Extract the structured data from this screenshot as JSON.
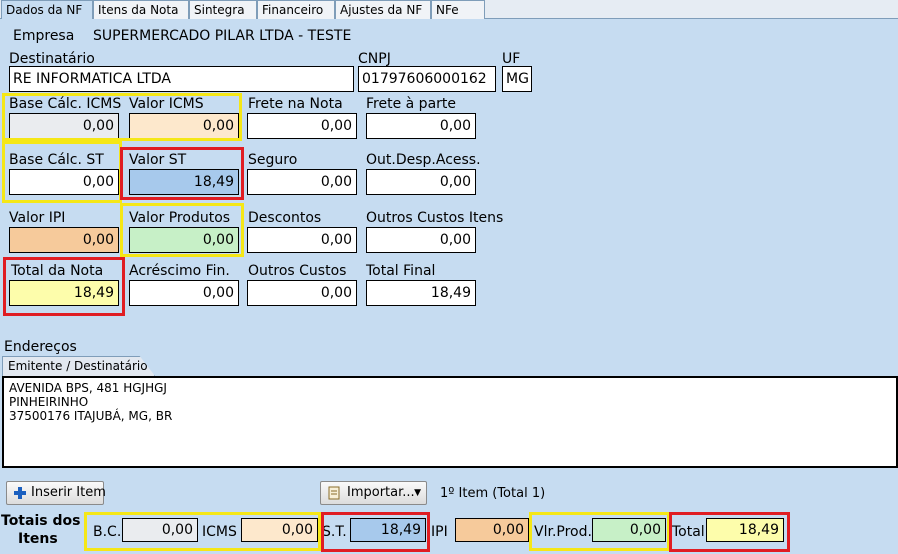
{
  "tabs": [
    "Dados da NF",
    "Itens da Nota",
    "Sintegra",
    "Financeiro",
    "Ajustes da NF",
    "NFe"
  ],
  "empresa": {
    "label": "Empresa",
    "value": "SUPERMERCADO PILAR LTDA - TESTE"
  },
  "destinatario": {
    "label": "Destinatário",
    "value": "RE INFORMATICA LTDA"
  },
  "cnpj": {
    "label": "CNPJ",
    "value": "01797606000162"
  },
  "uf": {
    "label": "UF",
    "value": "MG"
  },
  "fields": {
    "base_icms": {
      "label": "Base Cálc. ICMS",
      "value": "0,00"
    },
    "valor_icms": {
      "label": "Valor ICMS",
      "value": "0,00"
    },
    "frete_nota": {
      "label": "Frete na Nota",
      "value": "0,00"
    },
    "frete_parte": {
      "label": "Frete à parte",
      "value": "0,00"
    },
    "base_st": {
      "label": "Base Cálc. ST",
      "value": "0,00"
    },
    "valor_st": {
      "label": "Valor ST",
      "value": "18,49"
    },
    "seguro": {
      "label": "Seguro",
      "value": "0,00"
    },
    "out_desp": {
      "label": "Out.Desp.Acess.",
      "value": "0,00"
    },
    "valor_ipi": {
      "label": "Valor IPI",
      "value": "0,00"
    },
    "valor_produtos": {
      "label": "Valor Produtos",
      "value": "0,00"
    },
    "descontos": {
      "label": "Descontos",
      "value": "0,00"
    },
    "outros_custos_itens": {
      "label": "Outros Custos Itens",
      "value": "0,00"
    },
    "total_nota": {
      "label": "Total da Nota",
      "value": "18,49"
    },
    "acrescimo": {
      "label": "Acréscimo Fin.",
      "value": "0,00"
    },
    "outros_custos": {
      "label": "Outros Custos",
      "value": "0,00"
    },
    "total_final": {
      "label": "Total Final",
      "value": "18,49"
    }
  },
  "enderecos": {
    "label": "Endereços",
    "tab": "Emitente / Destinatário",
    "lines": [
      "AVENIDA BPS, 481 HGJHGJ",
      "PINHEIRINHO",
      "37500176 ITAJUBÁ, MG, BR"
    ]
  },
  "toolbar": {
    "inserir": "Inserir Item",
    "importar": "Importar...",
    "item_count": "1º Item (Total 1)"
  },
  "totais": {
    "label_line1": "Totais dos",
    "label_line2": "Itens",
    "bc": {
      "label": "B.C.",
      "value": "0,00"
    },
    "icms": {
      "label": "ICMS",
      "value": "0,00"
    },
    "st": {
      "label": "S.T.",
      "value": "18,49"
    },
    "ipi": {
      "label": "IPI",
      "value": "0,00"
    },
    "vlr_prod": {
      "label": "Vlr.Prod.",
      "value": "0,00"
    },
    "total": {
      "label": "Total",
      "value": "18,49"
    }
  },
  "colors": {
    "gray": "#eaecef",
    "peach": "#fde8cc",
    "blue": "#a7c9ec",
    "orange": "#f6ca9b",
    "green": "#c7f0c7",
    "yellow": "#fdfdab",
    "highlight_yellow": "#f5e716",
    "highlight_red": "#e01d23"
  }
}
